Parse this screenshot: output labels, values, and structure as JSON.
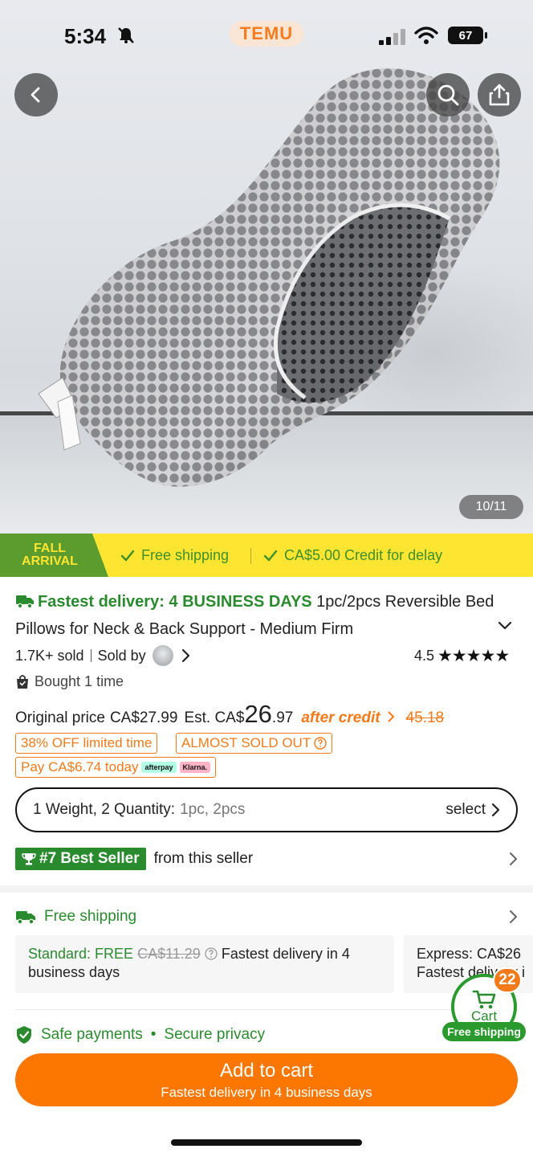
{
  "status_bar": {
    "time": "5:34",
    "battery": "67"
  },
  "logo": "TEMU",
  "gallery": {
    "counter": "10/11"
  },
  "promo": {
    "badge_line1": "FALL",
    "badge_line2": "ARRIVAL",
    "item1": "Free shipping",
    "item2": "CA$5.00 Credit for delay"
  },
  "product": {
    "delivery_tag": "Fastest delivery: 4 BUSINESS DAYS",
    "title": " 1pc/2pcs Reversible Bed Pillows for Neck & Back Support - Medium Firm",
    "sold": "1.7K+ sold",
    "sold_by": "Sold by",
    "rating": "4.5",
    "stars": "★★★★★",
    "bought": "Bought 1 time",
    "original_label": "Original price",
    "original_price": "CA$27.99",
    "est_label": "Est. CA$",
    "est_int": "26",
    "est_dec": ".97",
    "after_credit": "after credit",
    "list_price": "45.18",
    "tag_off": "38% OFF limited time",
    "tag_almost": "ALMOST SOLD OUT",
    "tag_pay": "Pay CA$6.74 today",
    "afterpay": "afterpay",
    "klarna": "Klarna."
  },
  "variant": {
    "label": "1 Weight, 2 Quantity:",
    "options": "1pc, 2pcs",
    "select": "select"
  },
  "best_seller": {
    "badge": "#7 Best Seller",
    "text": "from this seller"
  },
  "shipping": {
    "title": "Free shipping",
    "standard_label": "Standard: FREE",
    "standard_strike": "CA$11.29",
    "standard_desc": "Fastest delivery in 4",
    "standard_desc2": "business days",
    "express_line1": "Express: CA$26",
    "express_line2": "Fastest delivery i"
  },
  "safe": {
    "text1": "Safe payments",
    "dot": "•",
    "text2": "Secure privacy"
  },
  "cart": {
    "label": "Cart",
    "count": "22",
    "free_shipping": "Free shipping"
  },
  "add_to_cart": {
    "label": "Add to cart",
    "sub": "Fastest delivery in 4 business days"
  },
  "colors": {
    "brand_orange": "#fb7701",
    "green": "#2a8a2e",
    "promo_yellow": "#fde532"
  }
}
